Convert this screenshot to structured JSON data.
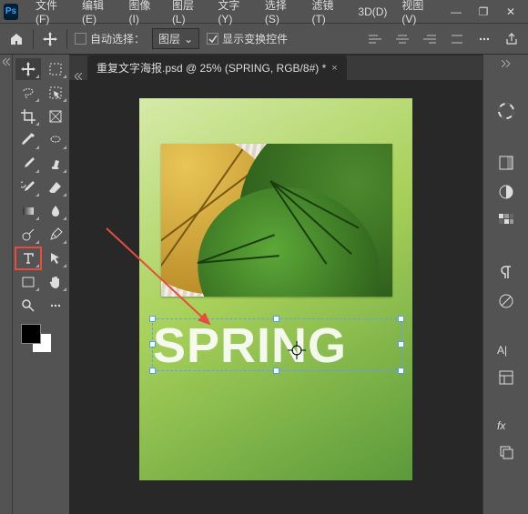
{
  "app": {
    "logo": "Ps"
  },
  "menu": {
    "items": [
      "文件(F)",
      "编辑(E)",
      "图像(I)",
      "图层(L)",
      "文字(Y)",
      "选择(S)",
      "滤镜(T)",
      "3D(D)",
      "视图(V)"
    ]
  },
  "window": {
    "min": "—",
    "max": "❐",
    "close": "✕"
  },
  "options": {
    "auto_select_label": "自动选择：",
    "auto_select_checked": false,
    "scope_label": "图层",
    "scope_caret": "⌄",
    "show_transform_label": "显示变换控件",
    "show_transform_checked": true
  },
  "document": {
    "tab_title": "重复文字海报.psd @ 25% (SPRING, RGB/8#) *",
    "close": "×"
  },
  "canvas": {
    "text": "SPRING"
  },
  "right_icons": [
    "swatches",
    "adjust",
    "palette",
    "properties",
    "paragraph",
    "maskedit",
    "character",
    "history",
    "styles",
    "layers"
  ],
  "tools": [
    [
      "move",
      "artboard"
    ],
    [
      "marquee",
      "lasso"
    ],
    [
      "crop",
      "frame"
    ],
    [
      "wand",
      "quick-select"
    ],
    [
      "brush",
      "clone"
    ],
    [
      "eraser",
      "history-brush"
    ],
    [
      "gradient",
      "blur"
    ],
    [
      "dodge",
      "pen"
    ],
    [
      "type",
      "path-select"
    ],
    [
      "rectangle",
      "hand"
    ],
    [
      "zoom",
      "ellipsis"
    ]
  ],
  "colors": {
    "fg": "#000000",
    "bg": "#ffffff"
  }
}
